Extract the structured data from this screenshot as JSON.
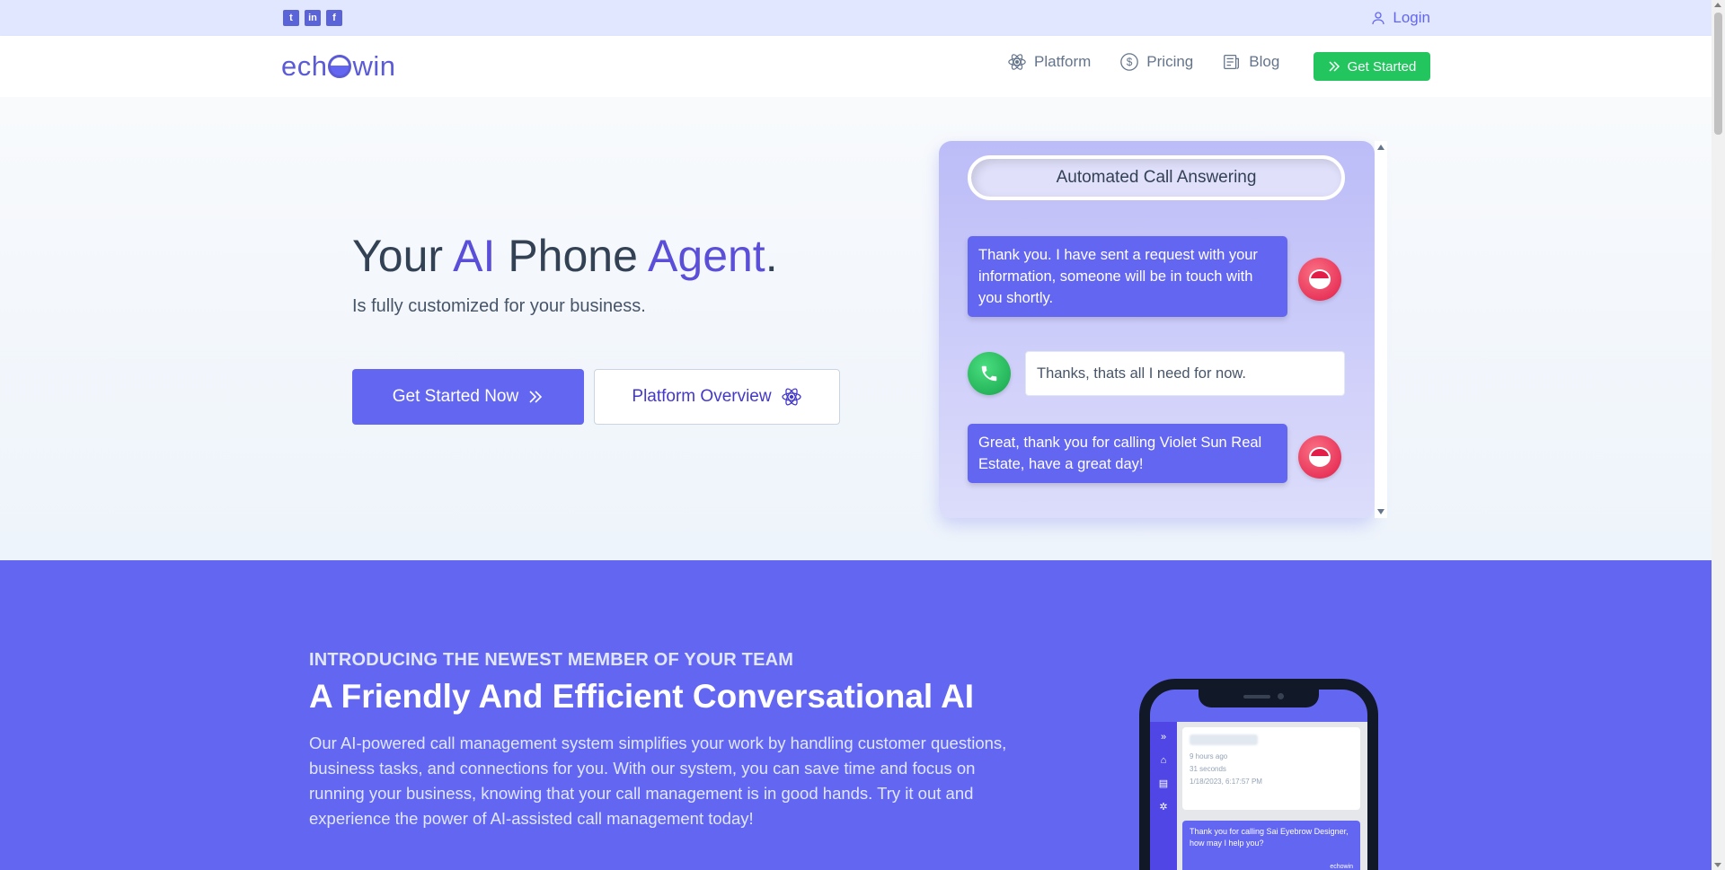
{
  "topbar": {
    "social": [
      {
        "icon": "twitter-icon",
        "glyph": "t"
      },
      {
        "icon": "linkedin-icon",
        "glyph": "in"
      },
      {
        "icon": "facebook-icon",
        "glyph": "f"
      }
    ],
    "login_label": "Login"
  },
  "header": {
    "logo_left": "ech",
    "logo_right": "win",
    "nav": [
      {
        "label": "Platform",
        "icon": "atom-icon"
      },
      {
        "label": "Pricing",
        "icon": "dollar-circle-icon"
      },
      {
        "label": "Blog",
        "icon": "newspaper-icon"
      }
    ],
    "cta_label": "Get Started"
  },
  "hero": {
    "title_parts": [
      "Your ",
      "AI",
      " Phone ",
      "Agent",
      "."
    ],
    "subtitle": "Is fully customized for your business.",
    "primary_button": "Get Started Now",
    "secondary_button": "Platform Overview"
  },
  "chat": {
    "heading": "Automated Call Answering",
    "messages": [
      {
        "from": "ai",
        "text": "Thank you. I have sent a request with your information, someone will be in touch with you shortly."
      },
      {
        "from": "caller",
        "text": "Thanks, thats all I need for now."
      },
      {
        "from": "ai",
        "text": "Great, thank you for calling Violet Sun Real Estate, have a great day!"
      }
    ]
  },
  "intro": {
    "kicker": "INTRODUCING THE NEWEST MEMBER OF YOUR TEAM",
    "title": "A Friendly And Efficient Conversational AI",
    "body": "Our AI-powered call management system simplifies your work by handling customer questions, business tasks, and connections for you. With our system, you can save time and focus on running your business, knowing that your call management is in good hands. Try it out and experience the power of AI-assisted call management today!"
  },
  "phone": {
    "card_lines": [
      "9 hours ago",
      "31 seconds",
      "1/18/2023, 6:17:57 PM"
    ],
    "message": "Thank you for calling Sai Eyebrow Designer, how may I help you?",
    "signature": "echowin"
  },
  "colors": {
    "brand": "#6366f1",
    "brand_dark": "#4338ca",
    "green": "#22c55e",
    "topbar_bg": "#e0e7ff"
  }
}
